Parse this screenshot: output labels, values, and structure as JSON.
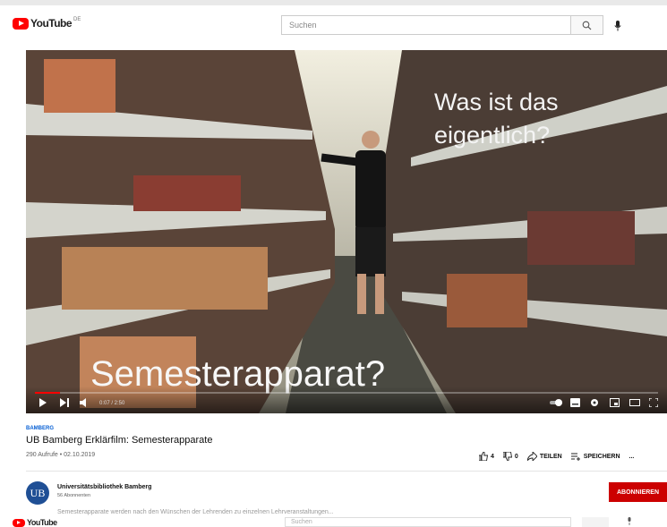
{
  "header": {
    "logo_text": "YouTube",
    "country_code": "DE",
    "search_placeholder": "Suchen"
  },
  "video": {
    "overlay_question": "Was ist das eigentlich?",
    "overlay_title": "Semesterapparat?",
    "time": "0:07 / 2:50",
    "progress": 0.04
  },
  "info": {
    "category": "BAMBERG",
    "title": "UB Bamberg Erklärfilm: Semesterapparate",
    "views_date": "290 Aufrufe • 02.10.2019",
    "likes": "4",
    "dislikes": "0",
    "share_label": "TEILEN",
    "save_label": "SPEICHERN",
    "more": "..."
  },
  "channel": {
    "avatar_text": "UB",
    "name": "Universitätsbibliothek Bamberg",
    "subscribers": "56 Abonnenten",
    "subscribe_label": "ABONNIEREN",
    "description": "Semesterapparate werden nach den Wünschen der Lehrenden zu einzelnen Lehrveranstaltungen..."
  },
  "ghost_header": {
    "logo_text": "YouTube",
    "search_placeholder": "Suchen"
  },
  "colors": {
    "brand_red": "#ff0000",
    "subscribe_red": "#cc0000",
    "link_blue": "#065fd4"
  }
}
